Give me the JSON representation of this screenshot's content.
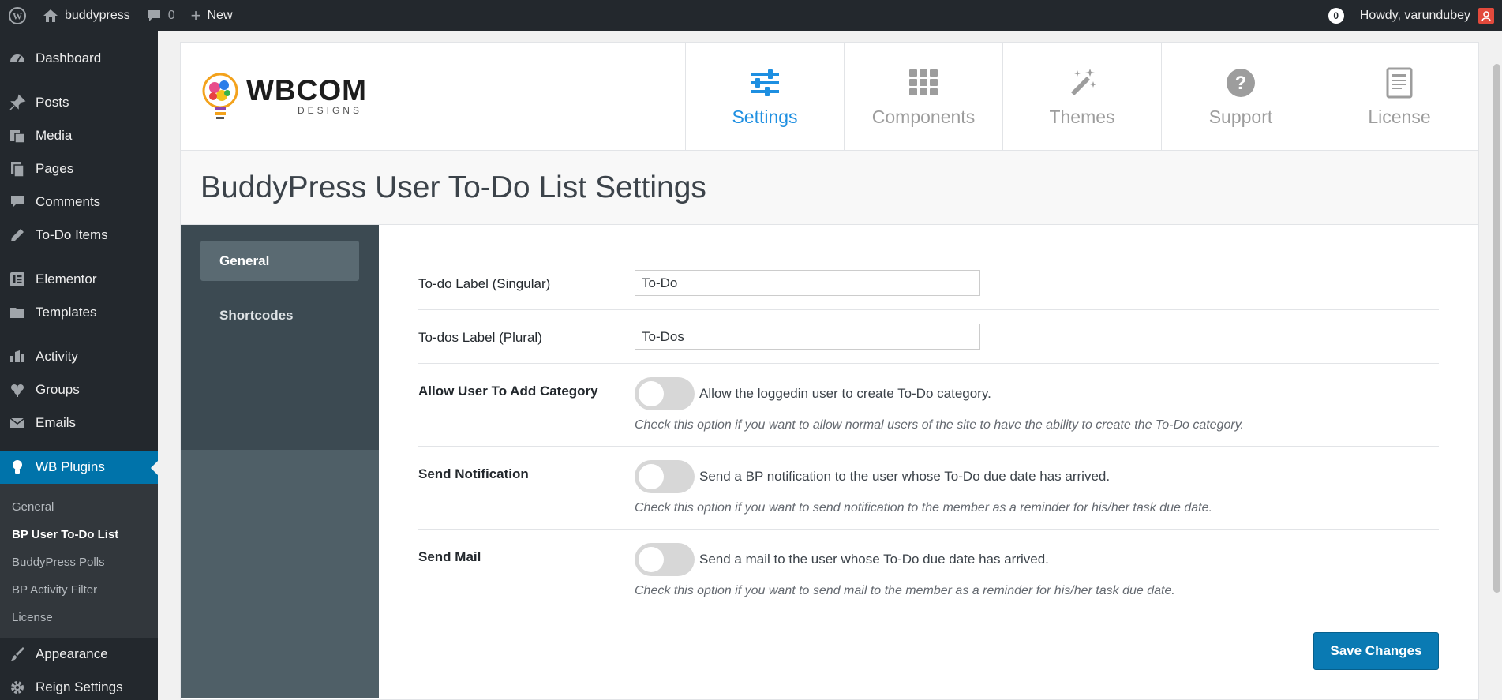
{
  "adminbar": {
    "site_name": "buddypress",
    "comments_count": "0",
    "new_label": "New",
    "notifications_count": "0",
    "greeting": "Howdy, varundubey"
  },
  "sidebar": {
    "items": [
      {
        "label": "Dashboard",
        "icon": "dashboard-icon"
      },
      {
        "label": "Posts",
        "icon": "pin-icon"
      },
      {
        "label": "Media",
        "icon": "media-icon"
      },
      {
        "label": "Pages",
        "icon": "pages-icon"
      },
      {
        "label": "Comments",
        "icon": "comment-icon"
      },
      {
        "label": "To-Do Items",
        "icon": "pencil-icon"
      },
      {
        "label": "Elementor",
        "icon": "elementor-icon"
      },
      {
        "label": "Templates",
        "icon": "folder-icon"
      },
      {
        "label": "Activity",
        "icon": "activity-icon"
      },
      {
        "label": "Groups",
        "icon": "groups-icon"
      },
      {
        "label": "Emails",
        "icon": "email-icon"
      },
      {
        "label": "WB Plugins",
        "icon": "bulb-icon"
      },
      {
        "label": "Appearance",
        "icon": "brush-icon"
      },
      {
        "label": "Reign Settings",
        "icon": "gear-icon"
      }
    ],
    "submenu": [
      "General",
      "BP User To-Do List",
      "BuddyPress Polls",
      "BP Activity Filter",
      "License"
    ]
  },
  "header": {
    "logo_main": "WBCOM",
    "logo_sub": "DESIGNS",
    "tabs": [
      {
        "label": "Settings",
        "icon": "sliders-icon"
      },
      {
        "label": "Components",
        "icon": "grid-icon"
      },
      {
        "label": "Themes",
        "icon": "wand-icon"
      },
      {
        "label": "Support",
        "icon": "question-icon"
      },
      {
        "label": "License",
        "icon": "document-icon"
      }
    ]
  },
  "page": {
    "title": "BuddyPress User To-Do List Settings"
  },
  "subnav": {
    "items": [
      "General",
      "Shortcodes"
    ]
  },
  "form": {
    "singular_label": "To-do Label (Singular)",
    "singular_value": "To-Do",
    "plural_label": "To-dos Label (Plural)",
    "plural_value": "To-Dos",
    "category_label": "Allow User To Add Category",
    "category_toggle_text": "Allow the loggedin user to create To-Do category.",
    "category_desc": "Check this option if you want to allow normal users of the site to have the ability to create the To-Do category.",
    "notification_label": "Send Notification",
    "notification_toggle_text": "Send a BP notification to the user whose To-Do due date has arrived.",
    "notification_desc": "Check this option if you want to send notification to the member as a reminder for his/her task due date.",
    "mail_label": "Send Mail",
    "mail_toggle_text": "Send a mail to the user whose To-Do due date has arrived.",
    "mail_desc": "Check this option if you want to send mail to the member as a reminder for his/her task due date.",
    "save_label": "Save Changes"
  },
  "colors": {
    "accent": "#1e8fe1",
    "admin_active": "#0073aa",
    "save_button": "#0a7ab3"
  }
}
